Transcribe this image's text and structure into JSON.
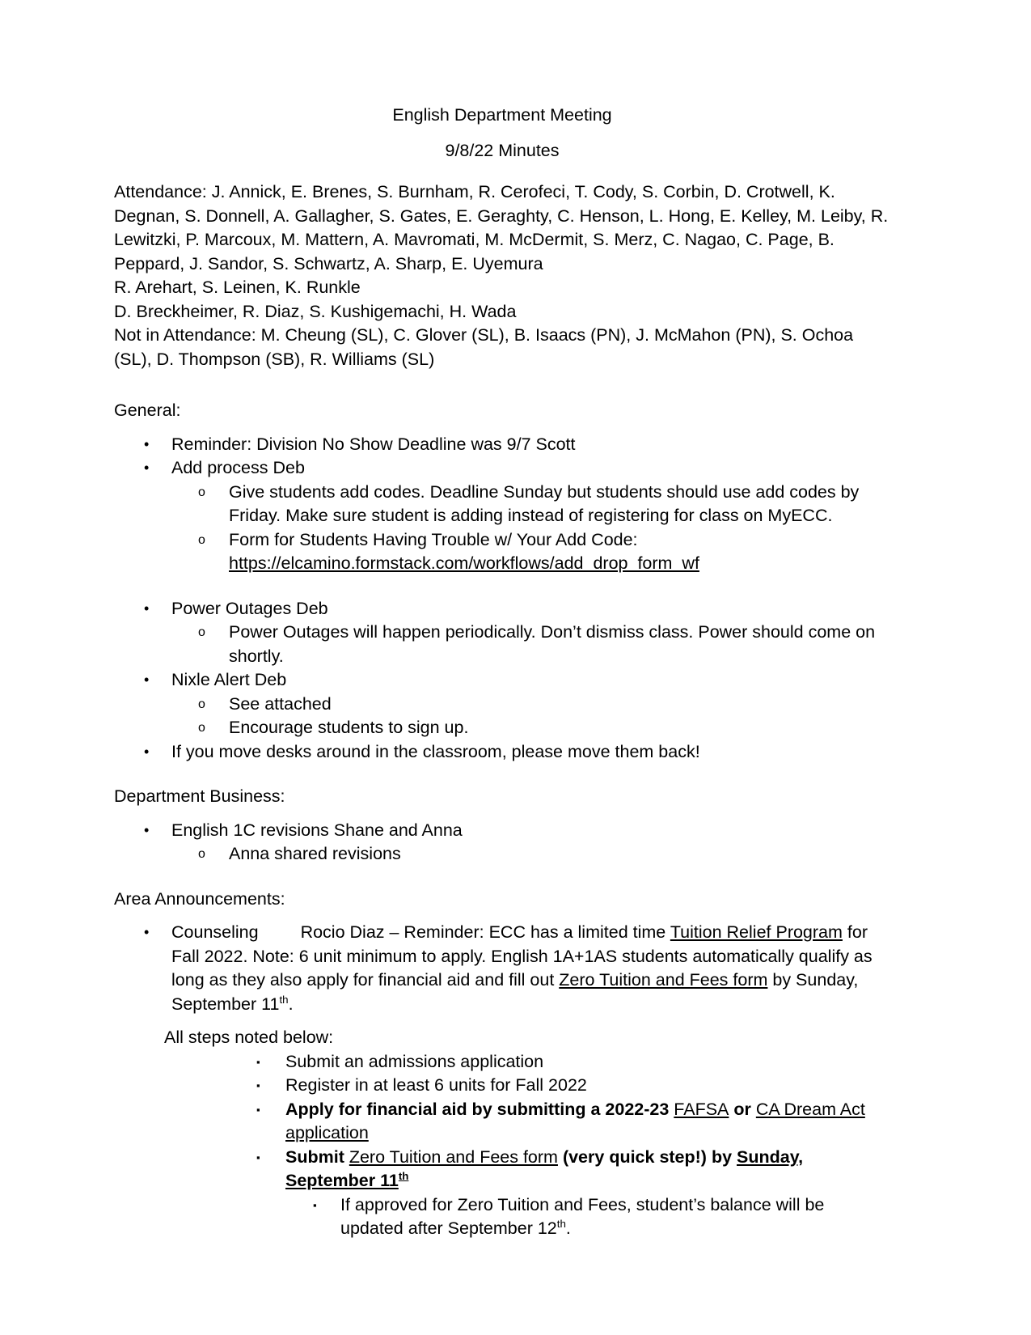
{
  "document": {
    "title_line": "English Department Meeting",
    "date_line": "9/8/22 Minutes"
  },
  "attendance": {
    "paragraph": "Attendance: J. Annick, E. Brenes, S. Burnham, R. Cerofeci, T. Cody, S. Corbin, D. Crotwell, K. Degnan, S. Donnell, A. Gallagher, S. Gates, E. Geraghty, C. Henson, L. Hong, E. Kelley, M. Leiby, R. Lewitzki, P. Marcoux, M. Mattern, A. Mavromati, M. McDermit, S. Merz, C. Nagao, C. Page, B. Peppard, J. Sandor, S. Schwartz, A. Sharp, E. Uyemura",
    "line_2": "R. Arehart, S. Leinen, K. Runkle",
    "line_3": "D. Breckheimer, R. Diaz, S. Kushigemachi, H. Wada",
    "not_in_attendance": "Not in Attendance: M. Cheung (SL), C. Glover (SL), B. Isaacs (PN), J. McMahon (PN), S. Ochoa (SL), D. Thompson (SB), R. Williams (SL)"
  },
  "sections": {
    "general_heading": "General:",
    "department_business_heading": "Department Business:",
    "area_announcements_heading": "Area Announcements:"
  },
  "general": {
    "b1": "Reminder: Division No Show Deadline was 9/7    Scott",
    "b2": "Add process        Deb",
    "b2_s1": "Give students add codes.  Deadline Sunday but students should use add codes by Friday.  Make sure student is adding instead of registering for class on MyECC.",
    "b2_s2": "Form for Students Having Trouble w/ Your Add Code:",
    "b2_s2_url": "https://elcamino.formstack.com/workflows/add_drop_form_wf",
    "b3": "Power Outages  Deb",
    "b3_s1": "Power Outages will happen periodically.  Don’t dismiss class. Power should come on shortly.",
    "b4": "Nixle Alert          Deb",
    "b4_s1": "See attached",
    "b4_s2": "Encourage students to sign up.",
    "b5": "If you move desks around in the classroom, please move them back!"
  },
  "department_business": {
    "b1": "English 1C revisions        Shane and Anna",
    "b1_s1": "Anna shared revisions"
  },
  "area_announcements": {
    "counseling_label": "Counseling",
    "counseling_p1": "Rocio Diaz – Reminder: ECC has a limited time ",
    "counseling_link1": "Tuition Relief Program",
    "counseling_p2": " for Fall 2022. Note: 6 unit minimum to apply.  English 1A+1AS students automatically qualify as long as they also apply for financial aid and fill out ",
    "counseling_link2": "Zero Tuition and Fees form",
    "counseling_p3": " by Sunday, September 11",
    "counseling_sup": "th",
    "counseling_p4": ".",
    "all_steps_label": "All steps noted below:",
    "step1": "Submit an admissions application",
    "step2": "Register in at least 6 units for Fall 2022",
    "step3_a": "Apply for financial aid by submitting a 2022-23 ",
    "step3_link1": "FAFSA",
    "step3_b": " or ",
    "step3_link2": "CA Dream Act application",
    "step4_a": "Submit ",
    "step4_link": "Zero Tuition and Fees form",
    "step4_b": " (very quick step!) by ",
    "step4_bold_link": "Sunday, September 11",
    "step4_sup": "th",
    "substep_a": "If approved for Zero Tuition and Fees, student’s balance will be updated after September 12",
    "substep_sup": "th",
    "substep_b": "."
  },
  "markers": {
    "disc": "•",
    "circle": "o",
    "square": "▪"
  }
}
